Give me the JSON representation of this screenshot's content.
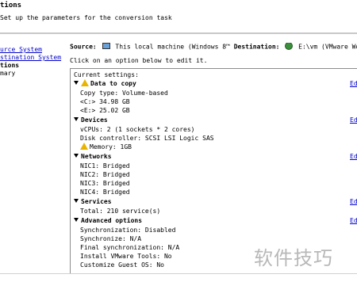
{
  "header": {
    "title": "tions",
    "subtitle": "Set up the parameters for the conversion task"
  },
  "nav": {
    "items": [
      {
        "label": "urce System",
        "state": "link"
      },
      {
        "label": "stination System",
        "state": "link"
      },
      {
        "label": "tions",
        "state": "current"
      },
      {
        "label": "mary",
        "state": "plain"
      }
    ]
  },
  "summary": {
    "source_label": "Source:",
    "source_value": "This local machine (Windows 8™",
    "source_icon": "monitor-icon",
    "destination_label": "Destination:",
    "destination_value": "E:\\vm (VMware Workst",
    "destination_icon": "globe-icon"
  },
  "instruction": "Click on an option below to edit it.",
  "panel": {
    "label": "Current settings:",
    "edit_label": "Edi",
    "sections": {
      "data_to_copy": {
        "title": "Data to copy",
        "warning": true,
        "rows": [
          "Copy type: Volume-based",
          "<C:>  34.98 GB",
          "<E:>  25.02 GB"
        ]
      },
      "devices": {
        "title": "Devices",
        "rows": [
          "vCPUs: 2 (1 sockets * 2 cores)",
          "Disk controller: SCSI LSI Logic SAS"
        ],
        "memory_row": "Memory: 1GB"
      },
      "networks": {
        "title": "Networks",
        "rows": [
          "NIC1: Bridged",
          "NIC2: Bridged",
          "NIC3: Bridged",
          "NIC4: Bridged"
        ]
      },
      "services": {
        "title": "Services",
        "rows": [
          "Total: 210 service(s)"
        ]
      },
      "advanced": {
        "title": "Advanced options",
        "rows": [
          "Synchronization: Disabled",
          "Synchronize: N/A",
          "Final synchronization: N/A",
          "Install VMware Tools: No",
          "Customize Guest OS: No"
        ]
      }
    }
  },
  "watermark": "软件技巧",
  "colors": {
    "link": "#0000cc",
    "warning": "#e8b400",
    "border": "#8c8c8c"
  }
}
